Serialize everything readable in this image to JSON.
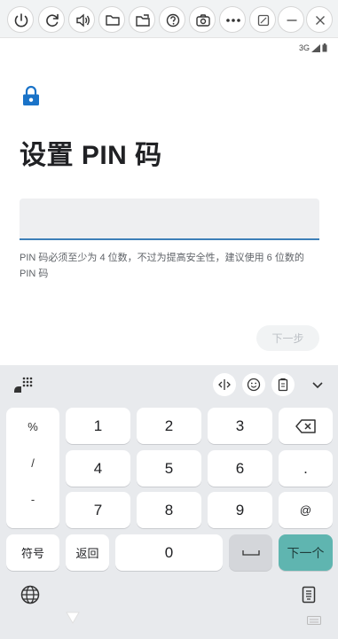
{
  "toolbar": {
    "buttons": [
      "power-icon",
      "rotate-icon",
      "volume-icon",
      "folder-icon",
      "files-icon",
      "help-icon",
      "screenshot-icon",
      "more-icon",
      "window-icon",
      "minimize-icon",
      "close-icon"
    ]
  },
  "status_bar": {
    "network": "3G"
  },
  "page": {
    "title": "设置 PIN 码",
    "pin_value": "",
    "hint": "PIN 码必须至少为 4 位数，不过为提高安全性，建议使用 6 位数的 PIN 码",
    "next_button": "下一步"
  },
  "keyboard": {
    "symbols": [
      "%",
      "/",
      "-"
    ],
    "digits": [
      "1",
      "2",
      "3",
      "4",
      "5",
      "6",
      "7",
      "8",
      "9",
      "0"
    ],
    "dot": ".",
    "at": "@",
    "symbols_key": "符号",
    "back_key": "返回",
    "next_key": "下一个",
    "colors": {
      "enter": "#5fb5b0",
      "background": "#e8eaed"
    }
  }
}
